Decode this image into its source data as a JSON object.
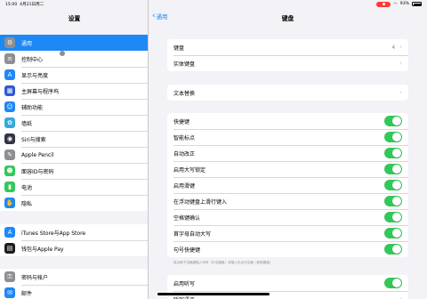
{
  "status": {
    "time": "15:00",
    "date": "4月21日周二",
    "battery": "93%"
  },
  "sidebar": {
    "title": "设置",
    "groups": [
      [
        {
          "label": "通用",
          "icon": "gear-icon",
          "color": "#8e8e93",
          "glyph": "⚙",
          "selected": true
        },
        {
          "label": "控制中心",
          "icon": "control-center-icon",
          "color": "#8e8e93",
          "glyph": "≡"
        },
        {
          "label": "显示与亮度",
          "icon": "display-brightness-icon",
          "color": "#1e88f4",
          "glyph": "A"
        },
        {
          "label": "主屏幕与程序坞",
          "icon": "home-screen-icon",
          "color": "#2f5bd3",
          "glyph": "▦"
        },
        {
          "label": "辅助功能",
          "icon": "accessibility-icon",
          "color": "#1e88f4",
          "glyph": "☺"
        },
        {
          "label": "墙纸",
          "icon": "wallpaper-icon",
          "color": "#35aadc",
          "glyph": "✿"
        },
        {
          "label": "Siri与搜索",
          "icon": "siri-icon",
          "color": "#333344",
          "glyph": "◉"
        },
        {
          "label": "Apple Pencil",
          "icon": "pencil-icon",
          "color": "#8e8e93",
          "glyph": "✎"
        },
        {
          "label": "面容ID与密码",
          "icon": "face-id-icon",
          "color": "#34c759",
          "glyph": "☻"
        },
        {
          "label": "电池",
          "icon": "battery-icon",
          "color": "#34c759",
          "glyph": "▮"
        },
        {
          "label": "隐私",
          "icon": "privacy-hand-icon",
          "color": "#1e88f4",
          "glyph": "✋"
        }
      ],
      [
        {
          "label": "iTunes Store与App Store",
          "icon": "app-store-icon",
          "color": "#1e88f4",
          "glyph": "A"
        },
        {
          "label": "钱包与Apple Pay",
          "icon": "wallet-icon",
          "color": "#1c1c1e",
          "glyph": "▤"
        }
      ],
      [
        {
          "label": "密码与帐户",
          "icon": "key-icon",
          "color": "#8e8e93",
          "glyph": "⚿"
        },
        {
          "label": "邮件",
          "icon": "mail-icon",
          "color": "#1e88f4",
          "glyph": "✉"
        }
      ]
    ]
  },
  "main": {
    "back_label": "通用",
    "title": "键盘",
    "section1": [
      {
        "label": "键盘",
        "value": "4"
      },
      {
        "label": "实体键盘",
        "value": ""
      }
    ],
    "section2": [
      {
        "label": "文本替换",
        "value": ""
      }
    ],
    "toggles": [
      {
        "label": "快捷键",
        "on": true
      },
      {
        "label": "智能标点",
        "on": true
      },
      {
        "label": "自动改正",
        "on": true
      },
      {
        "label": "启用大写锁定",
        "on": true
      },
      {
        "label": "启用滑键",
        "on": true
      },
      {
        "label": "在浮动键盘上滑行键入",
        "on": true
      },
      {
        "label": "空格键确认",
        "on": true
      },
      {
        "label": "首字母自动大写",
        "on": true
      },
      {
        "label": "句号快捷键",
        "on": true
      }
    ],
    "footnote": "轻点两下空格键插入句号（中文键盘）或插入句点与空格（其他键盘）",
    "section4": [
      {
        "label": "启用听写",
        "on": true
      },
      {
        "label": "听写语言",
        "value": ""
      }
    ],
    "accent_color": "#34c759"
  }
}
